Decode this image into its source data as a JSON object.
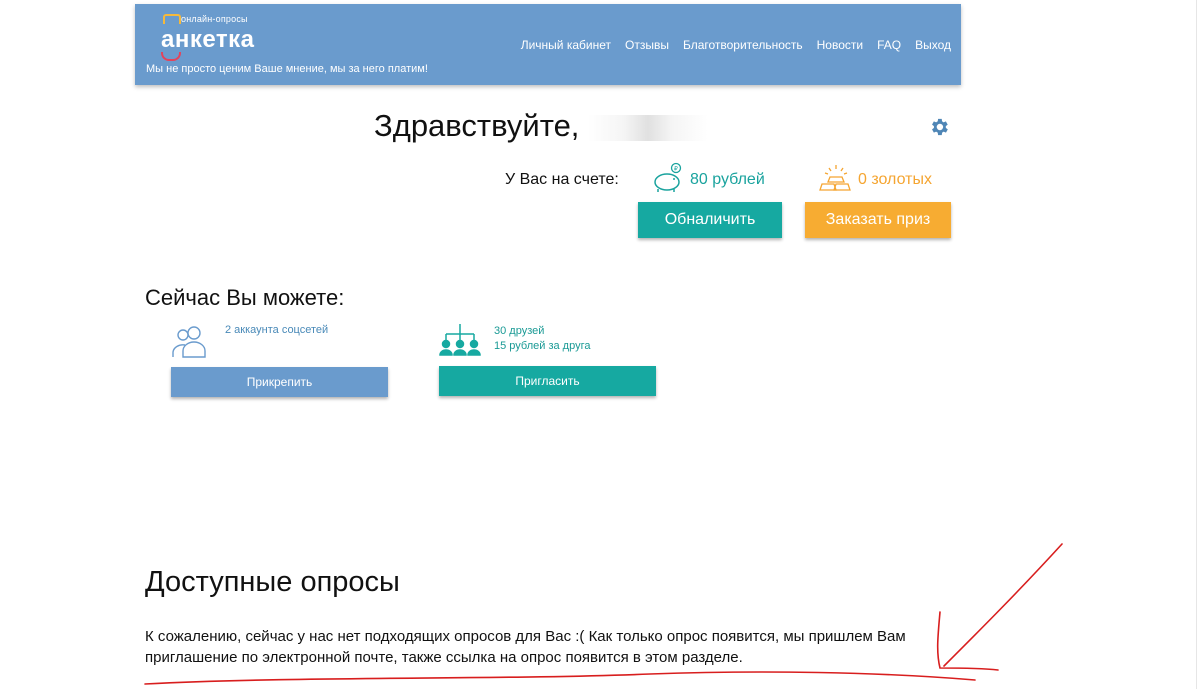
{
  "header": {
    "logo_small": "онлайн-опросы",
    "logo_main": "анкетка",
    "tagline": "Мы не просто ценим Ваше мнение, мы за него платим!",
    "nav": [
      "Личный кабинет",
      "Отзывы",
      "Благотворительность",
      "Новости",
      "FAQ",
      "Выход"
    ]
  },
  "greeting": {
    "text": "Здравствуйте,"
  },
  "balance": {
    "label": "У Вас на счете:",
    "rub_value": "80 рублей",
    "gold_value": "0 золотых",
    "cashout_label": "Обналичить",
    "prize_label": "Заказать приз"
  },
  "now": {
    "title": "Сейчас Вы можете:",
    "social_text": "2 аккаунта соцсетей",
    "attach_label": "Прикрепить",
    "friends_line1": "30 друзей",
    "friends_line2": "15 рублей за друга",
    "invite_label": "Пригласить"
  },
  "surveys": {
    "title": "Доступные опросы",
    "text": "К сожалению, сейчас у нас нет подходящих опросов для Вас :( Как только опрос появится, мы пришлем Вам приглашение по электронной почте, также ссылка на опрос появится в этом разделе."
  },
  "colors": {
    "header": "#6a9bcd",
    "teal": "#16a9a1",
    "orange": "#f7ac32",
    "annotation": "#d81e1e"
  }
}
